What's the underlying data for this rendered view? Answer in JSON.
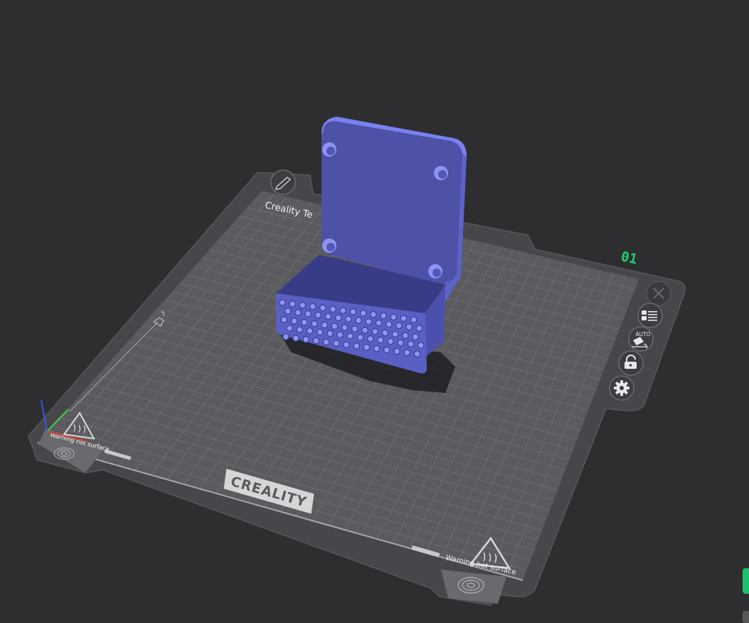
{
  "viewport": {
    "background": "#2e2e31"
  },
  "bed": {
    "brand_logo": "CREALITY",
    "corner_label": "Creality Te",
    "warning_left": "Warning hot surface",
    "warning_right": "Warning hot surface",
    "plate_number": "01",
    "plate_number_color": "#1fd06a",
    "surface_color": "#5a5a5e"
  },
  "plate_controls": [
    {
      "name": "close-plate-button",
      "icon": "close-icon"
    },
    {
      "name": "arrange-plate-button",
      "icon": "arrange-icon"
    },
    {
      "name": "auto-orient-button",
      "icon": "auto-orient-icon",
      "label": "AUTO"
    },
    {
      "name": "lock-plate-button",
      "icon": "lock-icon"
    },
    {
      "name": "plate-settings-button",
      "icon": "gear-icon"
    }
  ],
  "plate_name_edit": {
    "icon": "pencil-icon"
  },
  "axes": {
    "x_color": "#e23a3a",
    "y_color": "#3fcf3f",
    "z_color": "#3a52e6"
  },
  "model": {
    "color": "#6a71e0"
  },
  "sidebar_edge": {
    "accent_color": "#19c16a"
  }
}
